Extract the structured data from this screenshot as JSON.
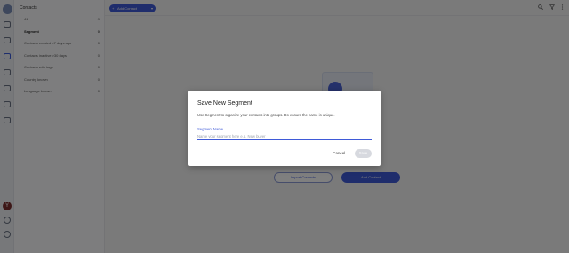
{
  "sidebar": {
    "title": "Contacts",
    "items": [
      {
        "label": "All",
        "count": "0"
      },
      {
        "label": "Segment",
        "count": "0"
      },
      {
        "label": "Contacts created <7 days ago",
        "count": "0"
      },
      {
        "label": "Contacts inactive >30 days",
        "count": "0"
      },
      {
        "label": "Contacts with tags",
        "count": "0"
      },
      {
        "label": "Country known",
        "count": "0"
      },
      {
        "label": "Language known",
        "count": "0"
      }
    ]
  },
  "topbar": {
    "add_contact_label": "Add Contact",
    "plus_glyph": "+",
    "dropdown_glyph": "▾"
  },
  "main": {
    "import_label": "Import Contacts",
    "add_contact_label": "Add Contact"
  },
  "modal": {
    "title": "Save New Segment",
    "description": "Use Segment to organize your contacts into groups. Do ensure the name is unique.",
    "field_label": "Segment Name",
    "field_placeholder": "Name your segment here e.g. New buyer",
    "field_value": "",
    "cancel_label": "Cancel",
    "save_label": "Save"
  },
  "user": {
    "avatar_letter": "Y"
  },
  "colors": {
    "accent": "#3f5ad8",
    "disabled": "#d7d9df"
  },
  "icons": [
    "dashboard-icon",
    "inbox-icon",
    "contacts-icon",
    "broadcast-icon",
    "workflow-icon",
    "reports-icon",
    "settings-icon",
    "search-icon",
    "filter-icon",
    "more-icon"
  ]
}
